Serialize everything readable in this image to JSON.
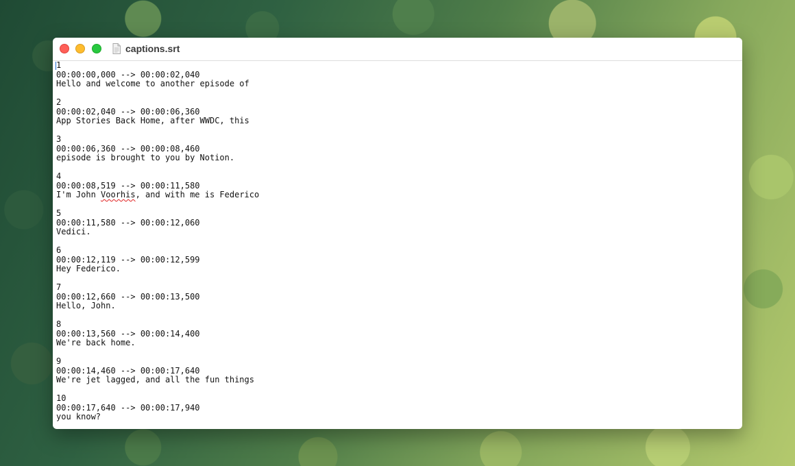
{
  "window": {
    "title": "captions.srt",
    "icon": "document-icon"
  },
  "document": {
    "lines": [
      "1",
      "00:00:00,000 --> 00:00:02,040",
      "Hello and welcome to another episode of",
      "",
      "2",
      "00:00:02,040 --> 00:00:06,360",
      "App Stories Back Home, after WWDC, this",
      "",
      "3",
      "00:00:06,360 --> 00:00:08,460",
      "episode is brought to you by Notion.",
      "",
      "4",
      "00:00:08,519 --> 00:00:11,580",
      "I'm John Voorhis, and with me is Federico",
      "",
      "5",
      "00:00:11,580 --> 00:00:12,060",
      "Vedici.",
      "",
      "6",
      "00:00:12,119 --> 00:00:12,599",
      "Hey Federico.",
      "",
      "7",
      "00:00:12,660 --> 00:00:13,500",
      "Hello, John.",
      "",
      "8",
      "00:00:13,560 --> 00:00:14,400",
      "We're back home.",
      "",
      "9",
      "00:00:14,460 --> 00:00:17,640",
      "We're jet lagged, and all the fun things",
      "",
      "10",
      "00:00:17,640 --> 00:00:17,940",
      "you know?"
    ]
  }
}
